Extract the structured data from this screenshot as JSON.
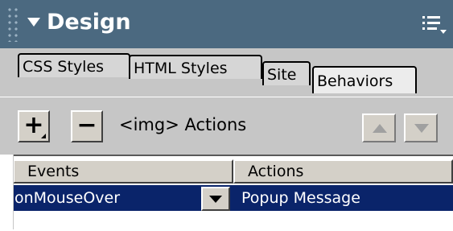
{
  "panel": {
    "title": "Design"
  },
  "tabs": [
    {
      "label": "CSS Styles"
    },
    {
      "label": "HTML Styles"
    },
    {
      "label": "Site"
    },
    {
      "label": "Behaviors",
      "active": true
    }
  ],
  "toolbar": {
    "add_label": "+",
    "remove_label": "−",
    "actions_label": "<img> Actions"
  },
  "table": {
    "headers": {
      "events": "Events",
      "actions": "Actions"
    },
    "rows": [
      {
        "event": "onMouseOver",
        "action": "Popup Message",
        "selected": true
      }
    ]
  },
  "colors": {
    "header_bg": "#4b6980",
    "panel_bg": "#c6c6c6",
    "selection": "#0a246a"
  },
  "icons": [
    "grip-icon",
    "collapse-arrow-icon",
    "options-menu-icon",
    "move-up-icon",
    "move-down-icon",
    "dropdown-arrow-icon"
  ]
}
